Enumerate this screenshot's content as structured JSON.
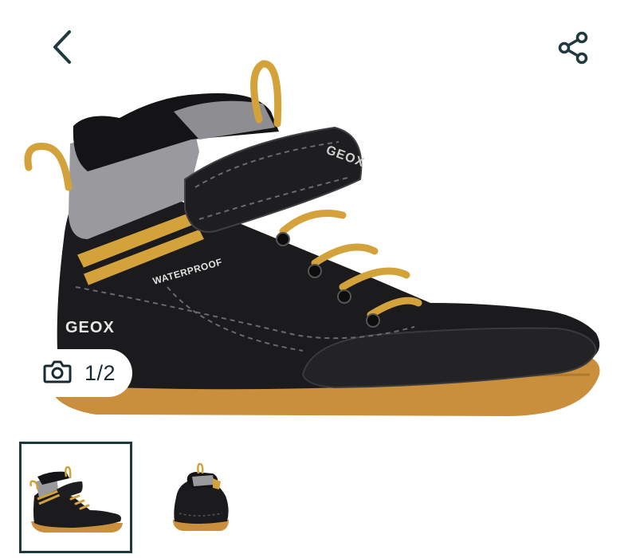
{
  "gallery": {
    "counter": "1/2",
    "brand_logo_text": "GEOX",
    "collar_logo_text": "GEOX",
    "feature_label": "WATERPROOF",
    "current_index": 1,
    "total_images": 2
  },
  "icons": {
    "back": "chevron-left-icon",
    "share": "share-icon",
    "camera": "camera-icon"
  },
  "thumbnails": [
    {
      "name": "thumbnail-1",
      "selected": true
    },
    {
      "name": "thumbnail-2",
      "selected": false
    }
  ],
  "colors": {
    "accent": "#1f3a3f",
    "boot_black": "#1b1b1d",
    "boot_grey": "#9a9a9e",
    "boot_mustard": "#d4a23a",
    "sole": "#c98f3d"
  }
}
